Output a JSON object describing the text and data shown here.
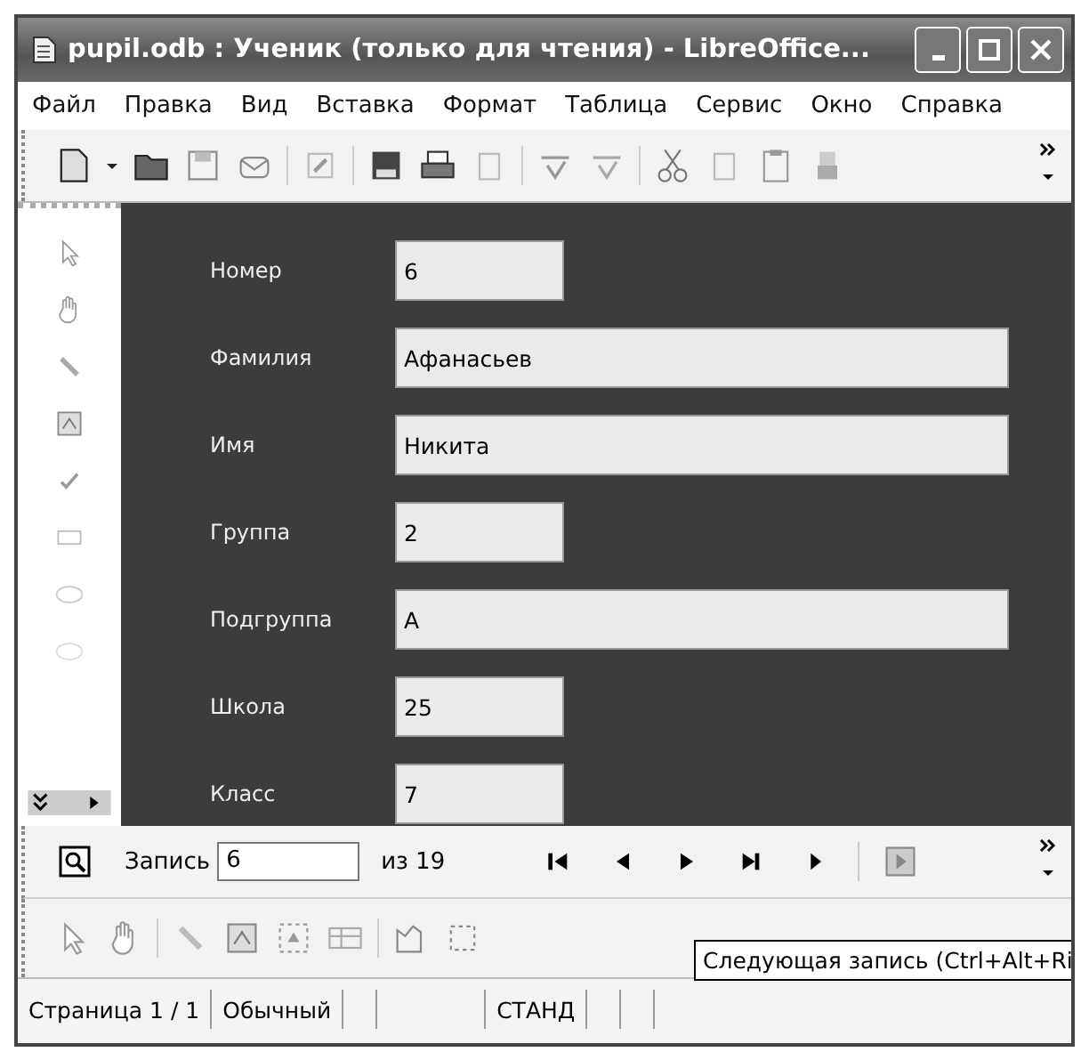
{
  "window": {
    "title": "pupil.odb : Ученик (только для чтения) - LibreOffice..."
  },
  "menu": [
    "Файл",
    "Правка",
    "Вид",
    "Вставка",
    "Формат",
    "Таблица",
    "Сервис",
    "Окно",
    "Справка"
  ],
  "form": {
    "fields": [
      {
        "label": "Номер",
        "value": "6",
        "kind": "short"
      },
      {
        "label": "Фамилия",
        "value": "Афанасьев",
        "kind": "wide"
      },
      {
        "label": "Имя",
        "value": "Никита",
        "kind": "wide"
      },
      {
        "label": "Группа",
        "value": "2",
        "kind": "short"
      },
      {
        "label": "Подгруппа",
        "value": "А",
        "kind": "wide"
      },
      {
        "label": "Школа",
        "value": "25",
        "kind": "short"
      },
      {
        "label": "Класс",
        "value": "7",
        "kind": "short"
      }
    ]
  },
  "navigation": {
    "label": "Запись",
    "record": "6",
    "total": "из 19"
  },
  "tooltip": "Следующая запись (Ctrl+Alt+Ri",
  "status_bar": [
    "Страница 1 / 1",
    "Обычный",
    "СТАНД"
  ]
}
